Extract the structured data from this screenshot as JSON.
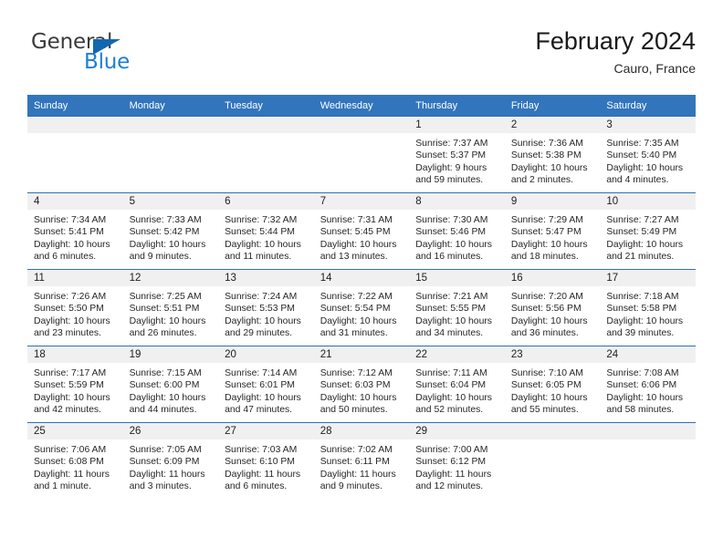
{
  "brand": {
    "line1": "General",
    "line2": "Blue",
    "triangle_color": "#1267b2",
    "blue_color": "#1c7fd4"
  },
  "header": {
    "title": "February 2024",
    "subtitle": "Cauro, France"
  },
  "theme": {
    "header_row_bg": "#3275bc",
    "row_border": "#2f6fb5",
    "daynum_bg": "#f0f0f0"
  },
  "weekdays": [
    "Sunday",
    "Monday",
    "Tuesday",
    "Wednesday",
    "Thursday",
    "Friday",
    "Saturday"
  ],
  "labels": {
    "sunrise": "Sunrise:",
    "sunset": "Sunset:",
    "daylight": "Daylight:"
  },
  "weeks": [
    [
      {
        "day": "",
        "empty": true
      },
      {
        "day": "",
        "empty": true
      },
      {
        "day": "",
        "empty": true
      },
      {
        "day": "",
        "empty": true
      },
      {
        "day": "1",
        "sunrise": "Sunrise: 7:37 AM",
        "sunset": "Sunset: 5:37 PM",
        "daylight1": "Daylight: 9 hours",
        "daylight2": "and 59 minutes."
      },
      {
        "day": "2",
        "sunrise": "Sunrise: 7:36 AM",
        "sunset": "Sunset: 5:38 PM",
        "daylight1": "Daylight: 10 hours",
        "daylight2": "and 2 minutes."
      },
      {
        "day": "3",
        "sunrise": "Sunrise: 7:35 AM",
        "sunset": "Sunset: 5:40 PM",
        "daylight1": "Daylight: 10 hours",
        "daylight2": "and 4 minutes."
      }
    ],
    [
      {
        "day": "4",
        "sunrise": "Sunrise: 7:34 AM",
        "sunset": "Sunset: 5:41 PM",
        "daylight1": "Daylight: 10 hours",
        "daylight2": "and 6 minutes."
      },
      {
        "day": "5",
        "sunrise": "Sunrise: 7:33 AM",
        "sunset": "Sunset: 5:42 PM",
        "daylight1": "Daylight: 10 hours",
        "daylight2": "and 9 minutes."
      },
      {
        "day": "6",
        "sunrise": "Sunrise: 7:32 AM",
        "sunset": "Sunset: 5:44 PM",
        "daylight1": "Daylight: 10 hours",
        "daylight2": "and 11 minutes."
      },
      {
        "day": "7",
        "sunrise": "Sunrise: 7:31 AM",
        "sunset": "Sunset: 5:45 PM",
        "daylight1": "Daylight: 10 hours",
        "daylight2": "and 13 minutes."
      },
      {
        "day": "8",
        "sunrise": "Sunrise: 7:30 AM",
        "sunset": "Sunset: 5:46 PM",
        "daylight1": "Daylight: 10 hours",
        "daylight2": "and 16 minutes."
      },
      {
        "day": "9",
        "sunrise": "Sunrise: 7:29 AM",
        "sunset": "Sunset: 5:47 PM",
        "daylight1": "Daylight: 10 hours",
        "daylight2": "and 18 minutes."
      },
      {
        "day": "10",
        "sunrise": "Sunrise: 7:27 AM",
        "sunset": "Sunset: 5:49 PM",
        "daylight1": "Daylight: 10 hours",
        "daylight2": "and 21 minutes."
      }
    ],
    [
      {
        "day": "11",
        "sunrise": "Sunrise: 7:26 AM",
        "sunset": "Sunset: 5:50 PM",
        "daylight1": "Daylight: 10 hours",
        "daylight2": "and 23 minutes."
      },
      {
        "day": "12",
        "sunrise": "Sunrise: 7:25 AM",
        "sunset": "Sunset: 5:51 PM",
        "daylight1": "Daylight: 10 hours",
        "daylight2": "and 26 minutes."
      },
      {
        "day": "13",
        "sunrise": "Sunrise: 7:24 AM",
        "sunset": "Sunset: 5:53 PM",
        "daylight1": "Daylight: 10 hours",
        "daylight2": "and 29 minutes."
      },
      {
        "day": "14",
        "sunrise": "Sunrise: 7:22 AM",
        "sunset": "Sunset: 5:54 PM",
        "daylight1": "Daylight: 10 hours",
        "daylight2": "and 31 minutes."
      },
      {
        "day": "15",
        "sunrise": "Sunrise: 7:21 AM",
        "sunset": "Sunset: 5:55 PM",
        "daylight1": "Daylight: 10 hours",
        "daylight2": "and 34 minutes."
      },
      {
        "day": "16",
        "sunrise": "Sunrise: 7:20 AM",
        "sunset": "Sunset: 5:56 PM",
        "daylight1": "Daylight: 10 hours",
        "daylight2": "and 36 minutes."
      },
      {
        "day": "17",
        "sunrise": "Sunrise: 7:18 AM",
        "sunset": "Sunset: 5:58 PM",
        "daylight1": "Daylight: 10 hours",
        "daylight2": "and 39 minutes."
      }
    ],
    [
      {
        "day": "18",
        "sunrise": "Sunrise: 7:17 AM",
        "sunset": "Sunset: 5:59 PM",
        "daylight1": "Daylight: 10 hours",
        "daylight2": "and 42 minutes."
      },
      {
        "day": "19",
        "sunrise": "Sunrise: 7:15 AM",
        "sunset": "Sunset: 6:00 PM",
        "daylight1": "Daylight: 10 hours",
        "daylight2": "and 44 minutes."
      },
      {
        "day": "20",
        "sunrise": "Sunrise: 7:14 AM",
        "sunset": "Sunset: 6:01 PM",
        "daylight1": "Daylight: 10 hours",
        "daylight2": "and 47 minutes."
      },
      {
        "day": "21",
        "sunrise": "Sunrise: 7:12 AM",
        "sunset": "Sunset: 6:03 PM",
        "daylight1": "Daylight: 10 hours",
        "daylight2": "and 50 minutes."
      },
      {
        "day": "22",
        "sunrise": "Sunrise: 7:11 AM",
        "sunset": "Sunset: 6:04 PM",
        "daylight1": "Daylight: 10 hours",
        "daylight2": "and 52 minutes."
      },
      {
        "day": "23",
        "sunrise": "Sunrise: 7:10 AM",
        "sunset": "Sunset: 6:05 PM",
        "daylight1": "Daylight: 10 hours",
        "daylight2": "and 55 minutes."
      },
      {
        "day": "24",
        "sunrise": "Sunrise: 7:08 AM",
        "sunset": "Sunset: 6:06 PM",
        "daylight1": "Daylight: 10 hours",
        "daylight2": "and 58 minutes."
      }
    ],
    [
      {
        "day": "25",
        "sunrise": "Sunrise: 7:06 AM",
        "sunset": "Sunset: 6:08 PM",
        "daylight1": "Daylight: 11 hours",
        "daylight2": "and 1 minute."
      },
      {
        "day": "26",
        "sunrise": "Sunrise: 7:05 AM",
        "sunset": "Sunset: 6:09 PM",
        "daylight1": "Daylight: 11 hours",
        "daylight2": "and 3 minutes."
      },
      {
        "day": "27",
        "sunrise": "Sunrise: 7:03 AM",
        "sunset": "Sunset: 6:10 PM",
        "daylight1": "Daylight: 11 hours",
        "daylight2": "and 6 minutes."
      },
      {
        "day": "28",
        "sunrise": "Sunrise: 7:02 AM",
        "sunset": "Sunset: 6:11 PM",
        "daylight1": "Daylight: 11 hours",
        "daylight2": "and 9 minutes."
      },
      {
        "day": "29",
        "sunrise": "Sunrise: 7:00 AM",
        "sunset": "Sunset: 6:12 PM",
        "daylight1": "Daylight: 11 hours",
        "daylight2": "and 12 minutes."
      },
      {
        "day": "",
        "empty": true
      },
      {
        "day": "",
        "empty": true
      }
    ]
  ]
}
